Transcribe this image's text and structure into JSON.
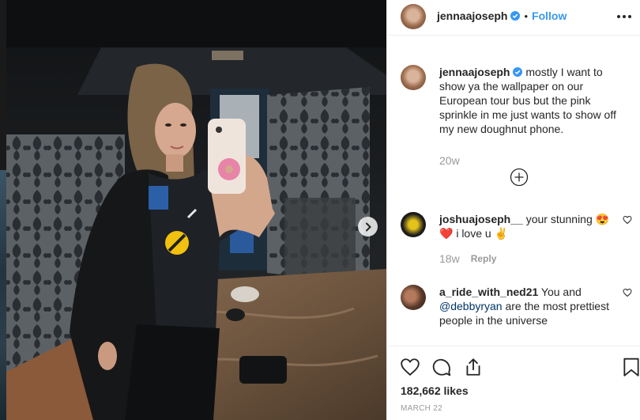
{
  "post": {
    "username": "jennaajoseph",
    "dot": "•",
    "follow_label": "Follow",
    "caption": "mostly I want to show ya the wallpaper on our European tour bus but the pink sprinkle in me just wants to show off my new doughnut phone.",
    "caption_age": "20w",
    "likes": "182,662 likes",
    "date": "MARCH 22"
  },
  "comments": [
    {
      "username": "joshuajoseph__",
      "text_part1": "your stunning 😍",
      "text_part2": "❤️ i love u ✌️",
      "age": "18w",
      "reply_label": "Reply"
    },
    {
      "username": "a_ride_with_ned21",
      "text_part1": "You and",
      "mention": "@debbyryan",
      "text_part2": "are the most prettiest people in the universe"
    }
  ],
  "icons": {
    "verified": "verified-badge-icon",
    "more": "more-options-icon",
    "load_more": "plus-circle-icon",
    "like": "heart-icon",
    "comment": "comment-bubble-icon",
    "share": "share-icon",
    "save": "bookmark-icon",
    "next": "chevron-right-icon"
  },
  "colors": {
    "link_blue": "#3897f0",
    "mention": "#003569",
    "text": "#262626",
    "muted": "#999999"
  }
}
